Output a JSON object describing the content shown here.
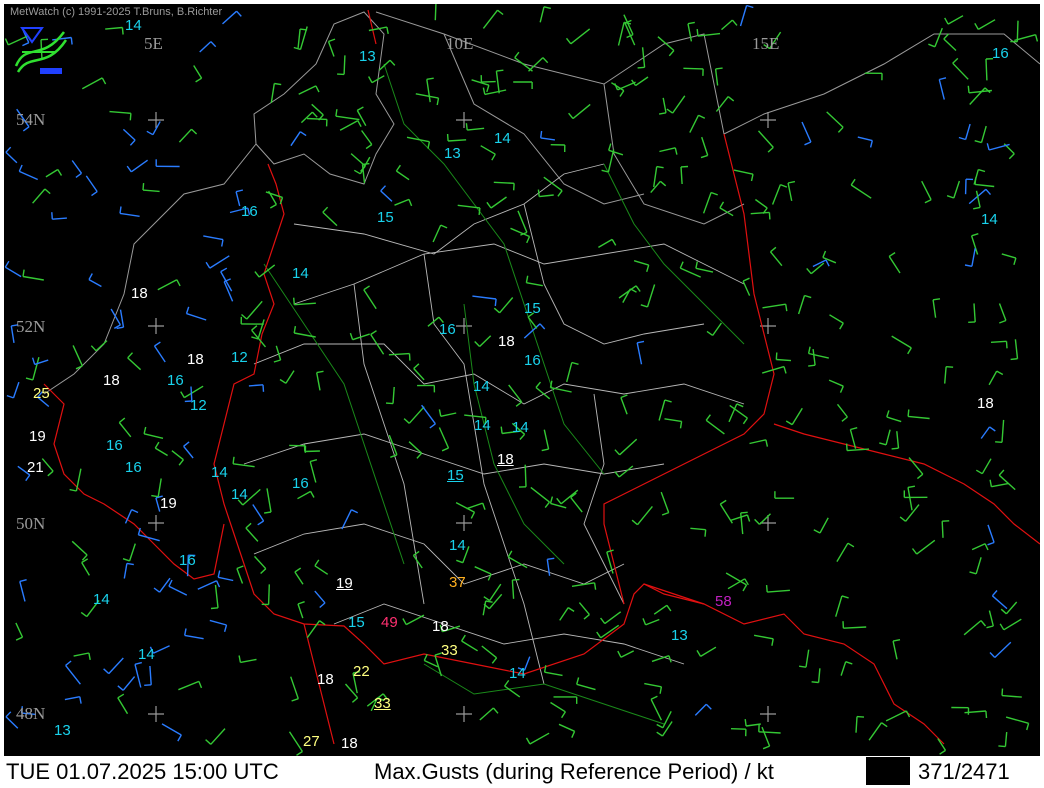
{
  "app": {
    "credit": "MetWatch  (c) 1991-2025 T.Bruns, B.Richter"
  },
  "footer": {
    "datetime": "TUE 01.07.2025 15:00 UTC",
    "product": "Max.Gusts (during Reference Period) / kt",
    "counter": "371/2471"
  },
  "axes": {
    "lon_labels": [
      "5E",
      "10E",
      "15E"
    ],
    "lat_labels": [
      "54N",
      "52N",
      "50N",
      "48N"
    ]
  },
  "colors": {
    "gust_13_16": "#19d2ec",
    "gust_17_21": "#ffffff",
    "gust_22_27": "#ffff80",
    "gust_33_37": "#ffb020",
    "gust_49": "#ff3070",
    "gust_58": "#c020c0",
    "border": "#e01010",
    "river": "#1a8a1a"
  },
  "stations": [
    {
      "v": "14",
      "c": "cy"
    },
    {
      "v": "13",
      "c": "cy"
    },
    {
      "v": "16",
      "c": "cy"
    },
    {
      "v": "14",
      "c": "cy"
    },
    {
      "v": "13",
      "c": "cy"
    },
    {
      "v": "16",
      "c": "cy"
    },
    {
      "v": "15",
      "c": "cy"
    },
    {
      "v": "14",
      "c": "cy"
    },
    {
      "v": "14",
      "c": "cy"
    },
    {
      "v": "18",
      "c": "wh"
    },
    {
      "v": "15",
      "c": "cy"
    },
    {
      "v": "16",
      "c": "cy"
    },
    {
      "v": "18",
      "c": "wh"
    },
    {
      "v": "18",
      "c": "wh"
    },
    {
      "v": "12",
      "c": "cy"
    },
    {
      "v": "16",
      "c": "cy"
    },
    {
      "v": "18",
      "c": "wh"
    },
    {
      "v": "16",
      "c": "cy"
    },
    {
      "v": "25",
      "c": "ye"
    },
    {
      "v": "12",
      "c": "cy"
    },
    {
      "v": "14",
      "c": "cy"
    },
    {
      "v": "19",
      "c": "wh"
    },
    {
      "v": "16",
      "c": "cy"
    },
    {
      "v": "14",
      "c": "cy"
    },
    {
      "v": "14",
      "c": "cy"
    },
    {
      "v": "18",
      "c": "wh"
    },
    {
      "v": "21",
      "c": "wh"
    },
    {
      "v": "16",
      "c": "cy"
    },
    {
      "v": "14",
      "c": "cy"
    },
    {
      "v": "15",
      "c": "cy",
      "u": true
    },
    {
      "v": "18",
      "c": "wh",
      "u": true
    },
    {
      "v": "14",
      "c": "cy"
    },
    {
      "v": "16",
      "c": "cy"
    },
    {
      "v": "19",
      "c": "wh"
    },
    {
      "v": "16",
      "c": "cy"
    },
    {
      "v": "14",
      "c": "cy"
    },
    {
      "v": "19",
      "c": "wh",
      "u": true
    },
    {
      "v": "37",
      "c": "or"
    },
    {
      "v": "14",
      "c": "cy"
    },
    {
      "v": "58",
      "c": "ma"
    },
    {
      "v": "15",
      "c": "cy"
    },
    {
      "v": "49",
      "c": "rd"
    },
    {
      "v": "18",
      "c": "wh"
    },
    {
      "v": "13",
      "c": "cy"
    },
    {
      "v": "14",
      "c": "cy"
    },
    {
      "v": "33",
      "c": "ye"
    },
    {
      "v": "22",
      "c": "ye"
    },
    {
      "v": "14",
      "c": "cy"
    },
    {
      "v": "18",
      "c": "wh"
    },
    {
      "v": "33",
      "c": "ye",
      "u": true
    },
    {
      "v": "13",
      "c": "cy"
    },
    {
      "v": "27",
      "c": "ye"
    },
    {
      "v": "18",
      "c": "wh"
    }
  ]
}
